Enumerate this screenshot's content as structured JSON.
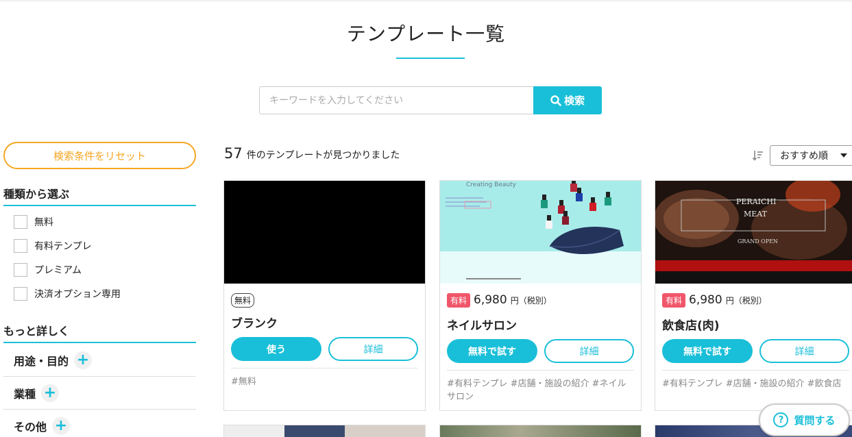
{
  "page": {
    "title": "テンプレート一覧"
  },
  "search": {
    "placeholder": "キーワードを入力してください",
    "button_label": "検索"
  },
  "sidebar": {
    "reset_label": "検索条件をリセット",
    "type_heading": "種類から選ぶ",
    "type_options": [
      "無料",
      "有料テンプレ",
      "プレミアム",
      "決済オプション専用"
    ],
    "more_heading": "もっと詳しく",
    "more_items": [
      "用途・目的",
      "業種",
      "その他"
    ]
  },
  "results": {
    "count": "57",
    "count_suffix": "件のテンプレートが見つかりました",
    "sort_value": "おすすめ順"
  },
  "cards": [
    {
      "badge": "無料",
      "name": "ブランク",
      "primary_label": "使う",
      "secondary_label": "詳細",
      "tags": "#無料"
    },
    {
      "badge": "有料",
      "price": "6,980",
      "price_unit": "円（税別）",
      "name": "ネイルサロン",
      "primary_label": "無料で試す",
      "secondary_label": "詳細",
      "tags": "#有料テンプレ #店舗・施設の紹介 #ネイルサロン",
      "thumb_text": "Creating Beauty"
    },
    {
      "badge": "有料",
      "price": "6,980",
      "price_unit": "円（税別）",
      "name": "飲食店(肉)",
      "primary_label": "無料で試す",
      "secondary_label": "詳細",
      "tags": "#有料テンプレ #店舗・施設の紹介 #飲食店",
      "thumb_lines": [
        "PERAICHI",
        "MEAT",
        "GRAND OPEN"
      ]
    }
  ],
  "help": {
    "label": "質問する"
  },
  "colors": {
    "accent": "#19bfd8",
    "reset": "#f5a623",
    "paid_badge": "#f0566a"
  }
}
